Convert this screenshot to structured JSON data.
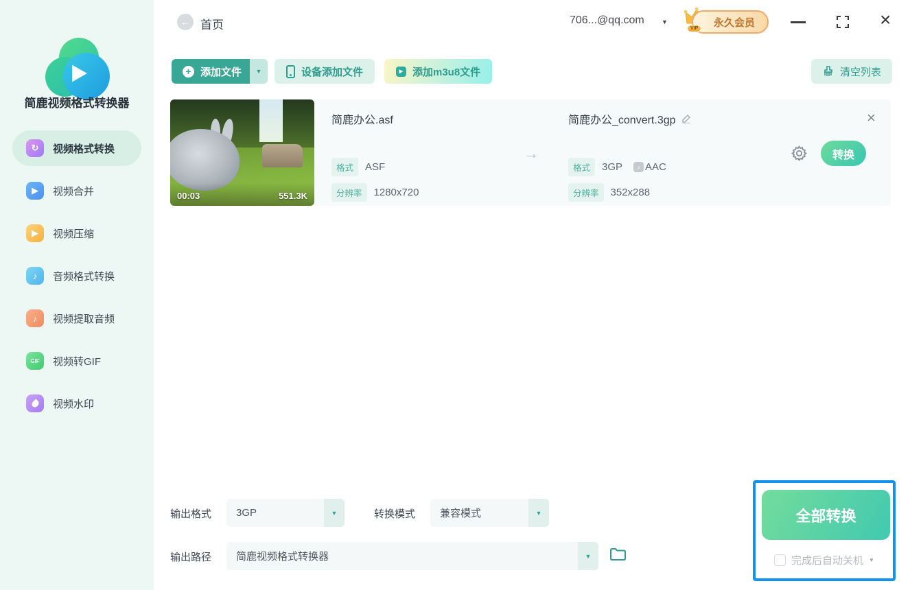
{
  "app": {
    "title": "简鹿视频格式转换器"
  },
  "header": {
    "page_title": "首页",
    "account": "706...@qq.com",
    "vip_text": "永久会员",
    "vip_tag": "VIP"
  },
  "sidebar": {
    "items": [
      {
        "label": "视频格式转换",
        "active": true
      },
      {
        "label": "视频合并"
      },
      {
        "label": "视频压缩"
      },
      {
        "label": "音频格式转换"
      },
      {
        "label": "视频提取音频"
      },
      {
        "label": "视频转GIF",
        "icon_text": "GIF"
      },
      {
        "label": "视频水印"
      }
    ]
  },
  "toolbar": {
    "add_file": "添加文件",
    "device_add": "设备添加文件",
    "add_m3u8": "添加m3u8文件",
    "clear_list": "清空列表"
  },
  "file": {
    "duration": "00:03",
    "size": "551.3K",
    "source": {
      "name": "简鹿办公.asf",
      "format_label": "格式",
      "format": "ASF",
      "resolution_label": "分辨率",
      "resolution": "1280x720"
    },
    "target": {
      "name": "简鹿办公_convert.3gp",
      "format_label": "格式",
      "format": "3GP",
      "audio_codec": "AAC",
      "resolution_label": "分辨率",
      "resolution": "352x288"
    },
    "convert_button": "转换"
  },
  "settings": {
    "output_format_label": "输出格式",
    "output_format_value": "3GP",
    "convert_mode_label": "转换模式",
    "convert_mode_value": "兼容模式",
    "output_path_label": "输出路径",
    "output_path_value": "简鹿视频格式转换器"
  },
  "footer": {
    "convert_all": "全部转换",
    "auto_shutdown": "完成后自动关机"
  },
  "colors": {
    "accent_teal": "#2e9d8e",
    "sidebar_bg": "#edf8f4",
    "highlight_blue": "#1192ef",
    "vip_orange": "#c0762f",
    "convert_gradient_start": "#74dc9c",
    "convert_gradient_end": "#41c9b0"
  }
}
